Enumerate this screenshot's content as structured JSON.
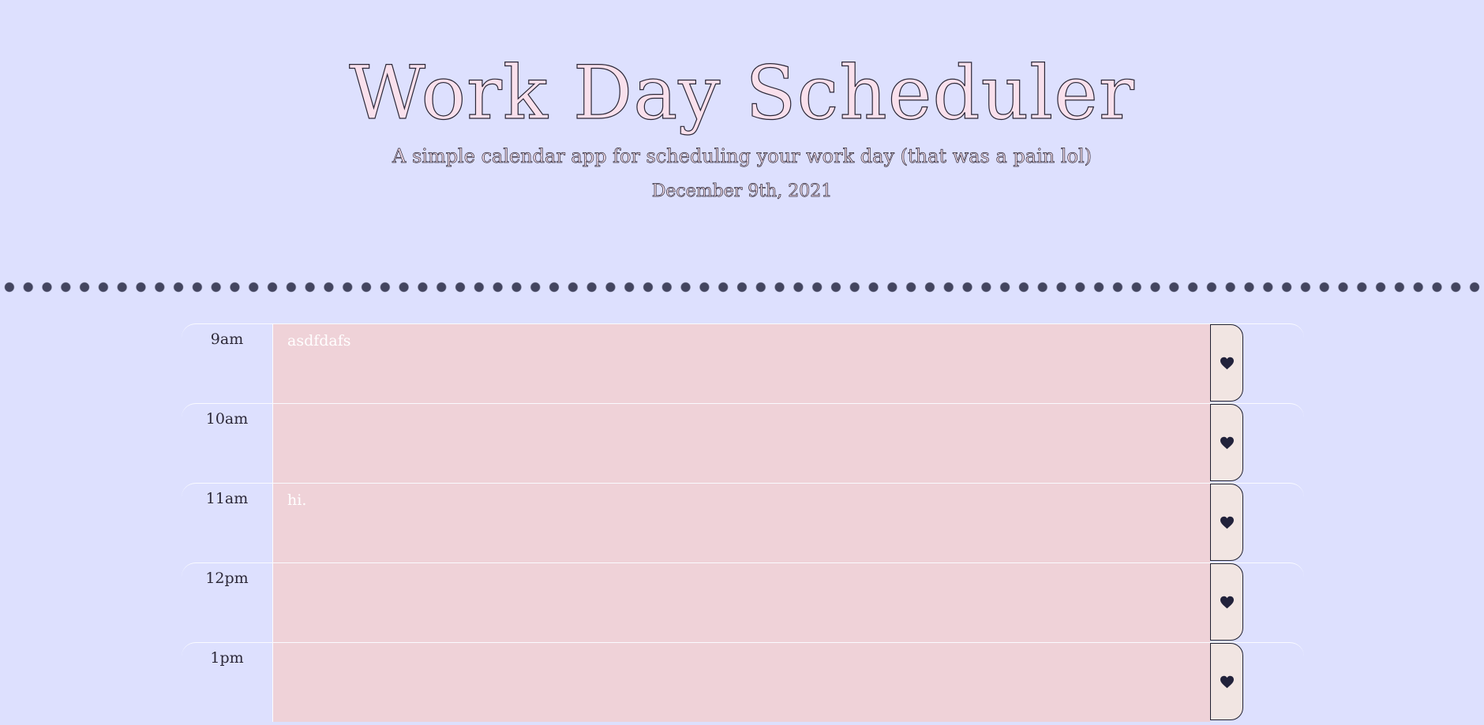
{
  "header": {
    "title": "Work Day Scheduler",
    "lead": "A simple calendar app for scheduling your work day (that was a pain lol)",
    "date": "December 9th, 2021"
  },
  "colors": {
    "background": "#dde0fe",
    "row_past": "#efd2d8",
    "save_button": "#f1e5e2",
    "icon": "#22223b",
    "dots": "#43455f"
  },
  "rows": [
    {
      "hour": "9am",
      "text": "asdfdafs",
      "save_icon": "heart-icon"
    },
    {
      "hour": "10am",
      "text": "",
      "save_icon": "heart-icon"
    },
    {
      "hour": "11am",
      "text": "hi.",
      "save_icon": "heart-icon"
    },
    {
      "hour": "12pm",
      "text": "",
      "save_icon": "heart-icon"
    },
    {
      "hour": "1pm",
      "text": "",
      "save_icon": "heart-icon"
    }
  ]
}
